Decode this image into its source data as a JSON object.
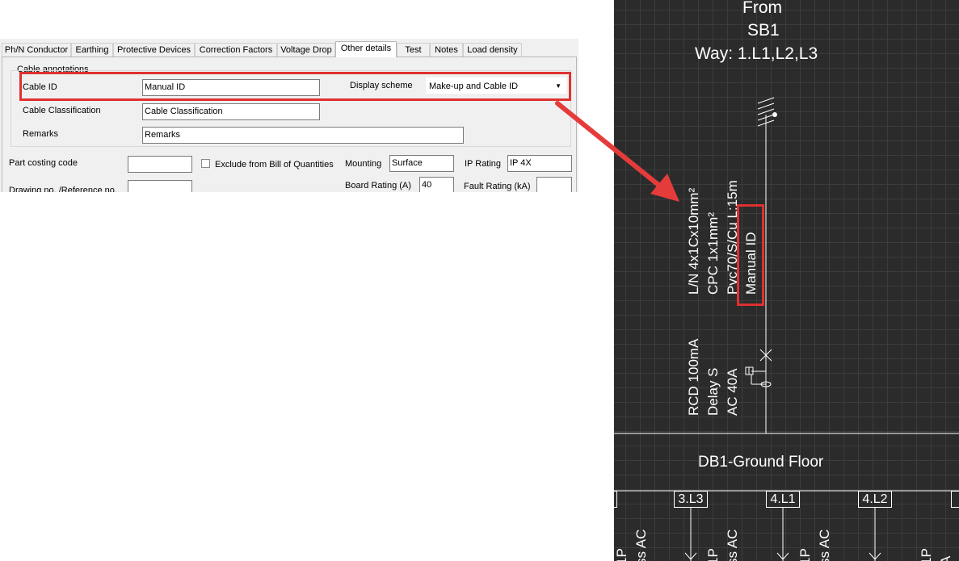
{
  "tabs": [
    "Ph/N Conductor",
    "Earthing",
    "Protective Devices",
    "Correction Factors",
    "Voltage Drop",
    "Other details",
    "Test",
    "Notes",
    "Load density"
  ],
  "active_tab_index": 5,
  "section_title": "Cable annotations",
  "fields": {
    "cable_id": {
      "label": "Cable ID",
      "value": "Manual ID"
    },
    "display_scheme": {
      "label": "Display scheme",
      "value": "Make-up and Cable ID"
    },
    "cable_classification": {
      "label": "Cable Classification",
      "value": "Cable Classification"
    },
    "remarks": {
      "label": "Remarks",
      "value": "Remarks"
    },
    "part_costing_code": {
      "label": "Part costing code",
      "value": ""
    },
    "exclude_boq": {
      "label": "Exclude from Bill of Quantities",
      "checked": false
    },
    "mounting": {
      "label": "Mounting",
      "value": "Surface"
    },
    "ip_rating": {
      "label": "IP Rating",
      "value": "IP 4X"
    },
    "drawing_no": {
      "label": "Drawing no. /Reference no.",
      "value": ""
    },
    "board_rating": {
      "label": "Board Rating (A)",
      "value": "40"
    },
    "fault_rating": {
      "label": "Fault Rating (kA)",
      "value": ""
    }
  },
  "drawing": {
    "from_label": "From",
    "source": "SB1",
    "way": "Way: 1.L1,L2,L3",
    "cable_lines": [
      "L/N 4x1Cx10mm²",
      "CPC  1x1mm²",
      "Pvc70/S/Cu L:15m",
      "Manual ID"
    ],
    "rcd_lines": [
      "RCD 100mA",
      "Delay S",
      "AC 40A"
    ],
    "board_title": "DB1-Ground Floor",
    "ways": [
      "3.L3",
      "4.L1",
      "4.L2"
    ],
    "bottom_fragments": [
      "1P",
      "ss AC",
      "1P",
      "ss AC",
      "1P",
      "ss AC",
      "1P",
      "A"
    ]
  },
  "colors": {
    "highlight": "#e03030",
    "canvas_bg": "#2b2b2b",
    "grid": "#3c3c3c"
  }
}
